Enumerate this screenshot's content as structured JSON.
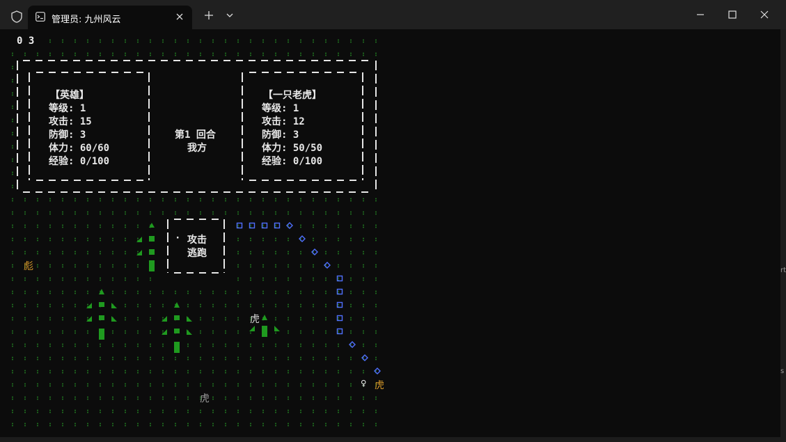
{
  "window": {
    "tab_title": "管理员: 九州风云",
    "tab_icon": "terminal-icon",
    "new_tab_icon": "plus-icon",
    "dropdown_icon": "chevron-down-icon",
    "controls": [
      "minimize-icon",
      "maximize-icon",
      "close-icon"
    ]
  },
  "colors": {
    "terminal_bg": "#0c0c0c",
    "grass_dot": "#1f6e1f",
    "tree": "#1f9a1f",
    "path_blue": "#4f6fff",
    "tiger_label": "#d99a2a",
    "text": "#e6e6e6"
  },
  "hud": {
    "line": "0 3"
  },
  "battle": {
    "hero": {
      "name": "【英雄】",
      "level": "等级: 1",
      "attack": "攻击: 15",
      "defense": "防御: 3",
      "stamina": "体力: 60/60",
      "exp": "经验: 0/100"
    },
    "enemy": {
      "name": "【一只老虎】",
      "level": "等级: 1",
      "attack": "攻击: 12",
      "defense": "防御: 3",
      "stamina": "体力: 50/50",
      "exp": "经验: 0/100"
    },
    "round": "第1 回合",
    "turn": "我方"
  },
  "menu": {
    "cursor": "·",
    "items": [
      "攻击",
      "逃跑"
    ]
  },
  "map_labels": {
    "tiger_glyph": "虎",
    "biao_glyph": "彪",
    "player_glyph": "♀"
  }
}
